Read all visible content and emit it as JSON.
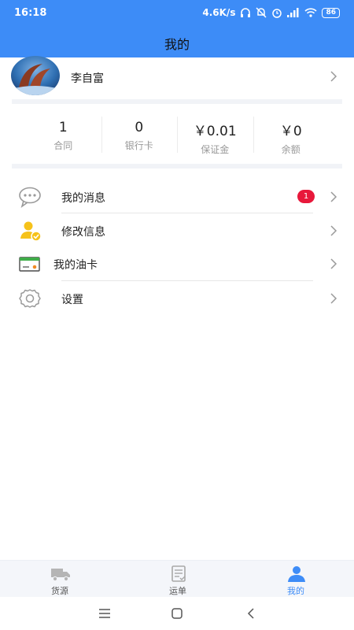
{
  "status_bar": {
    "time": "16:18",
    "net_speed": "4.6K/s",
    "battery": "86"
  },
  "header": {
    "title": "我的"
  },
  "profile": {
    "name": "李自富"
  },
  "stats": [
    {
      "value": "1",
      "label": "合同"
    },
    {
      "value": "0",
      "label": "银行卡"
    },
    {
      "value": "￥0.01",
      "label": "保证金"
    },
    {
      "value": "￥0",
      "label": "余额"
    }
  ],
  "menu": {
    "messages": {
      "label": "我的消息",
      "badge": "1",
      "icon": "chat-bubble-icon"
    },
    "edit_info": {
      "label": "修改信息",
      "icon": "user-check-icon"
    },
    "fuel_card": {
      "label": "我的油卡",
      "icon": "card-icon"
    },
    "settings": {
      "label": "设置",
      "icon": "gear-icon"
    }
  },
  "tabs": [
    {
      "label": "货源",
      "icon": "truck-icon",
      "active": false
    },
    {
      "label": "运单",
      "icon": "document-icon",
      "active": false
    },
    {
      "label": "我的",
      "icon": "person-icon",
      "active": true
    }
  ],
  "colors": {
    "primary": "#3d8cf7",
    "badge": "#e8183b",
    "icon_gray": "#9a9a9a",
    "user_icon": "#f6c21a"
  }
}
